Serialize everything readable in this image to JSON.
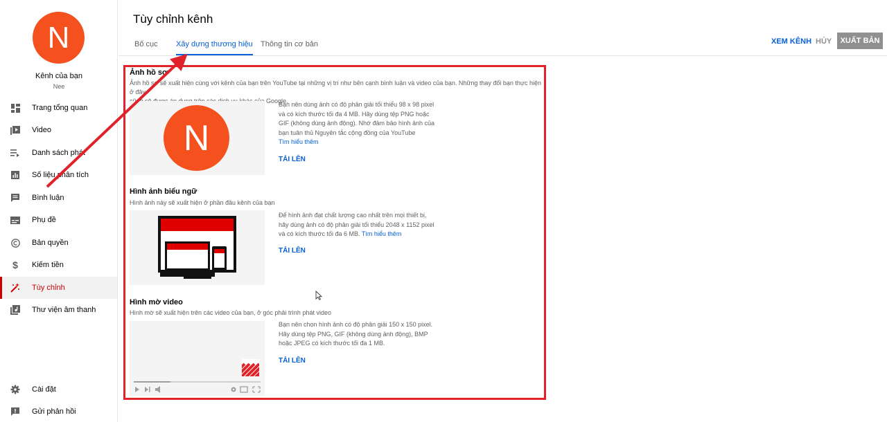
{
  "channel": {
    "avatar_letter": "N",
    "name": "Kênh của bạn",
    "handle": "Nee"
  },
  "sidebar": {
    "items": [
      {
        "label": "Trang tổng quan",
        "icon": "dashboard-icon"
      },
      {
        "label": "Video",
        "icon": "video-icon"
      },
      {
        "label": "Danh sách phát",
        "icon": "playlist-icon"
      },
      {
        "label": "Số liệu phân tích",
        "icon": "analytics-icon"
      },
      {
        "label": "Bình luận",
        "icon": "comments-icon"
      },
      {
        "label": "Phụ đề",
        "icon": "subtitles-icon"
      },
      {
        "label": "Bản quyền",
        "icon": "copyright-icon"
      },
      {
        "label": "Kiếm tiền",
        "icon": "dollar-icon"
      },
      {
        "label": "Tùy chỉnh",
        "icon": "magic-wand-icon",
        "active": true
      },
      {
        "label": "Thư viện âm thanh",
        "icon": "audio-library-icon"
      }
    ],
    "bottom": [
      {
        "label": "Cài đặt",
        "icon": "gear-icon"
      },
      {
        "label": "Gửi phản hồi",
        "icon": "feedback-icon"
      }
    ]
  },
  "header": {
    "title": "Tùy chỉnh kênh",
    "tabs": [
      {
        "label": "Bố cục"
      },
      {
        "label": "Xây dựng thương hiệu",
        "active": true
      },
      {
        "label": "Thông tin cơ bản"
      }
    ],
    "view_channel": "XEM KÊNH",
    "cancel": "HỦY",
    "publish": "XUẤT BẢN"
  },
  "sections": {
    "profile": {
      "title": "Ảnh hồ sơ",
      "desc1": "Ảnh hồ sơ sẽ xuất hiện cùng với kênh của bạn trên YouTube tại những vị trí như bên cạnh bình luận và video của bạn. Những thay đổi bạn thực hiện ở đây",
      "desc2": "cũng sẽ được áp dụng trên các dịch vụ khác của Google.",
      "info": "Bạn nên dùng ảnh có độ phân giải tối thiểu 98 x 98 pixel và có kích thước tối đa 4 MB. Hãy dùng tệp PNG hoặc GIF (không dùng ảnh động). Nhớ đảm bảo hình ảnh của bạn tuân thủ Nguyên tắc cộng đồng của YouTube",
      "link": "Tìm hiểu thêm",
      "upload": "TẢI LÊN",
      "avatar_letter": "N"
    },
    "banner": {
      "title": "Hình ảnh biểu ngữ",
      "desc": "Hình ảnh này sẽ xuất hiện ở phần đầu kênh của bạn",
      "info": "Để hình ảnh đạt chất lượng cao nhất trên mọi thiết bị, hãy dùng ảnh có độ phân giải tối thiểu 2048 x 1152 pixel và có kích thước tối đa 6 MB.",
      "link": "Tìm hiểu thêm",
      "upload": "TẢI LÊN"
    },
    "watermark": {
      "title": "Hình mờ video",
      "desc": "Hình mờ sẽ xuất hiện trên các video của bạn, ở góc phải trình phát video",
      "info": "Bạn nên chọn hình ảnh có độ phân giải 150 x 150 pixel. Hãy dùng tệp PNG, GIF (không dùng ảnh động), BMP hoặc JPEG có kích thước tối đa 1 MB.",
      "upload": "TẢI LÊN"
    }
  },
  "colors": {
    "accent": "#065fd4",
    "active_red": "#cc0000",
    "annotation_red": "#e0222b",
    "avatar": "#f4511e"
  }
}
